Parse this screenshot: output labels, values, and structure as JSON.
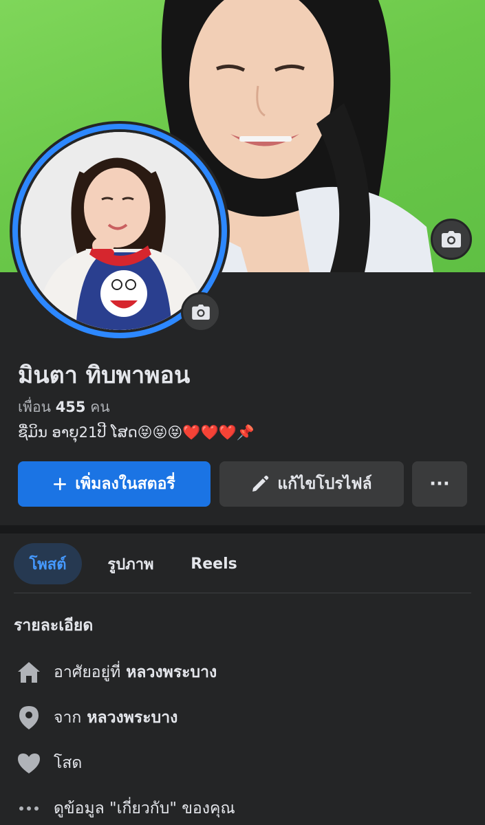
{
  "profile": {
    "name": "มินตา ทิบพาพอน",
    "friends_prefix": "เพื่อน",
    "friends_count": "455",
    "friends_suffix": "คน",
    "bio": "ຊື່ມິນ ອາຍຸ21ປີ ໂສດ😝😝😝❤️❤️❤️📌"
  },
  "actions": {
    "add_story_label": "เพิ่มลงในสตอรี่",
    "edit_profile_label": "แก้ไขโปรไฟล์",
    "more_label": "···"
  },
  "tabs": [
    {
      "label": "โพสต์",
      "active": true
    },
    {
      "label": "รูปภาพ",
      "active": false
    },
    {
      "label": "Reels",
      "active": false
    }
  ],
  "details": {
    "title": "รายละเอียด",
    "lives_in_prefix": "อาศัยอยู่ที่",
    "lives_in_value": "หลวงพระบาง",
    "from_prefix": "จาก",
    "from_value": "หลวงพระบาง",
    "relationship": "โสด",
    "about_link": "ดูข้อมูล \"เกี่ยวกับ\" ของคุณ"
  },
  "colors": {
    "accent": "#1b74e4",
    "background": "#242526",
    "cover_green": "#6cc94a",
    "avatar_ring": "#2d88ff"
  },
  "icons": {
    "cover_camera": "camera-icon",
    "avatar_camera": "camera-icon",
    "add_story": "plus-icon",
    "edit_profile": "pencil-icon",
    "more": "more-dots-icon",
    "lives_in": "home-icon",
    "from": "location-pin-icon",
    "relationship": "heart-icon",
    "about": "more-dots-icon"
  }
}
